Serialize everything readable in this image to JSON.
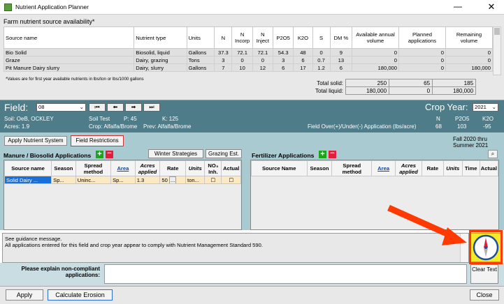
{
  "window": {
    "title": "Nutrient Application Planner",
    "minimize": "—",
    "close": "✕"
  },
  "sources": {
    "section_label": "Farm nutrient source availability*",
    "columns": [
      "Source name",
      "Nutrient type",
      "Units",
      "N",
      "N Incorp",
      "N Inject",
      "P2O5",
      "K2O",
      "S",
      "DM %",
      "Available annual volume",
      "Planned applications",
      "Remaining volume"
    ],
    "rows": [
      [
        "Bio Solid",
        "Biosolid, liquid",
        "Gallons",
        "37.3",
        "72.1",
        "72.1",
        "54.3",
        "48",
        "0",
        "9",
        "0",
        "0",
        "0"
      ],
      [
        "Graze",
        "Dairy, grazing",
        "Tons",
        "3",
        "0",
        "0",
        "3",
        "6",
        "0.7",
        "13",
        "0",
        "0",
        "0"
      ],
      [
        "Pit Manure Dairy slurry",
        "Dairy, slurry",
        "Gallons",
        "7",
        "10",
        "12",
        "6",
        "17",
        "1.2",
        "6",
        "180,000",
        "0",
        "180,000"
      ]
    ],
    "footnote": "*Values are for first year available nutrients in lbs/ton or lbs/1000 gallons",
    "totals": {
      "solid_label": "Total solid:",
      "solid": [
        "250",
        "65",
        "185"
      ],
      "liquid_label": "Total liquid:",
      "liquid": [
        "180,000",
        "0",
        "180,000"
      ]
    }
  },
  "field": {
    "label": "Field:",
    "value": "08",
    "nav": [
      "⏮",
      "⬅",
      "➡",
      "⏭"
    ],
    "soil": "Soil: OeB, OCKLEY",
    "soil_test": "Soil Test",
    "p": "P: 45",
    "k": "K: 125",
    "acres": "Acres: 1.9",
    "crop": "Crop: Alfalfa/Brome",
    "prev": "Prev: Alfalfa/Brome",
    "over_under_label": "Field Over(+)/Under(-) Application (lbs/acre)"
  },
  "crop_year": {
    "label": "Crop Year:",
    "value": "2021",
    "n_label": "N",
    "p_label": "P2O5",
    "k_label": "K2O",
    "n": "68",
    "p": "103",
    "k": "-95"
  },
  "toolbar": {
    "apply_ns": "Apply Nutrient System",
    "field_restrictions": "Field Restrictions",
    "season_range": "Fall 2020 thru Summer 2021"
  },
  "manure": {
    "title": "Manure / Biosolid Applications",
    "winter": "Winter Strategies",
    "grazing": "Grazing Est.",
    "columns": [
      "Source name",
      "Season",
      "Spread method",
      "Area",
      "Acres applied",
      "Rate",
      "Units",
      "NO₃ Inh.",
      "Actual"
    ],
    "row": {
      "source": "Solid Dairy ...",
      "season": "Sp...",
      "method": "Uninc...",
      "area": "Sp...",
      "acres": "1.3",
      "rate": "50",
      "rate_more": "...",
      "units": "ton..."
    }
  },
  "fertilizer": {
    "title": "Fertilizer Applications",
    "columns": [
      "Source Name",
      "Season",
      "Spread method",
      "Area",
      "Acres applied",
      "Rate",
      "Units",
      "Time",
      "Actual"
    ]
  },
  "guidance": {
    "line1": "See guidance message.",
    "line2": "All applications entered for this field and crop year appear to comply with Nutrient Management Standard 590."
  },
  "explain": {
    "label": "Please explain non-compliant applications:",
    "value": "",
    "clear": "Clear Text"
  },
  "bottom": {
    "apply": "Apply",
    "calc": "Calculate Erosion",
    "close": "Close"
  },
  "colors": {
    "header_band": "#4e7c88",
    "panel": "#a9cad0",
    "highlight": "#ff3a00",
    "compass_bg": "#f4ea2a"
  },
  "icons": [
    "compass-icon",
    "plus-icon",
    "minus-icon",
    "search-icon"
  ]
}
